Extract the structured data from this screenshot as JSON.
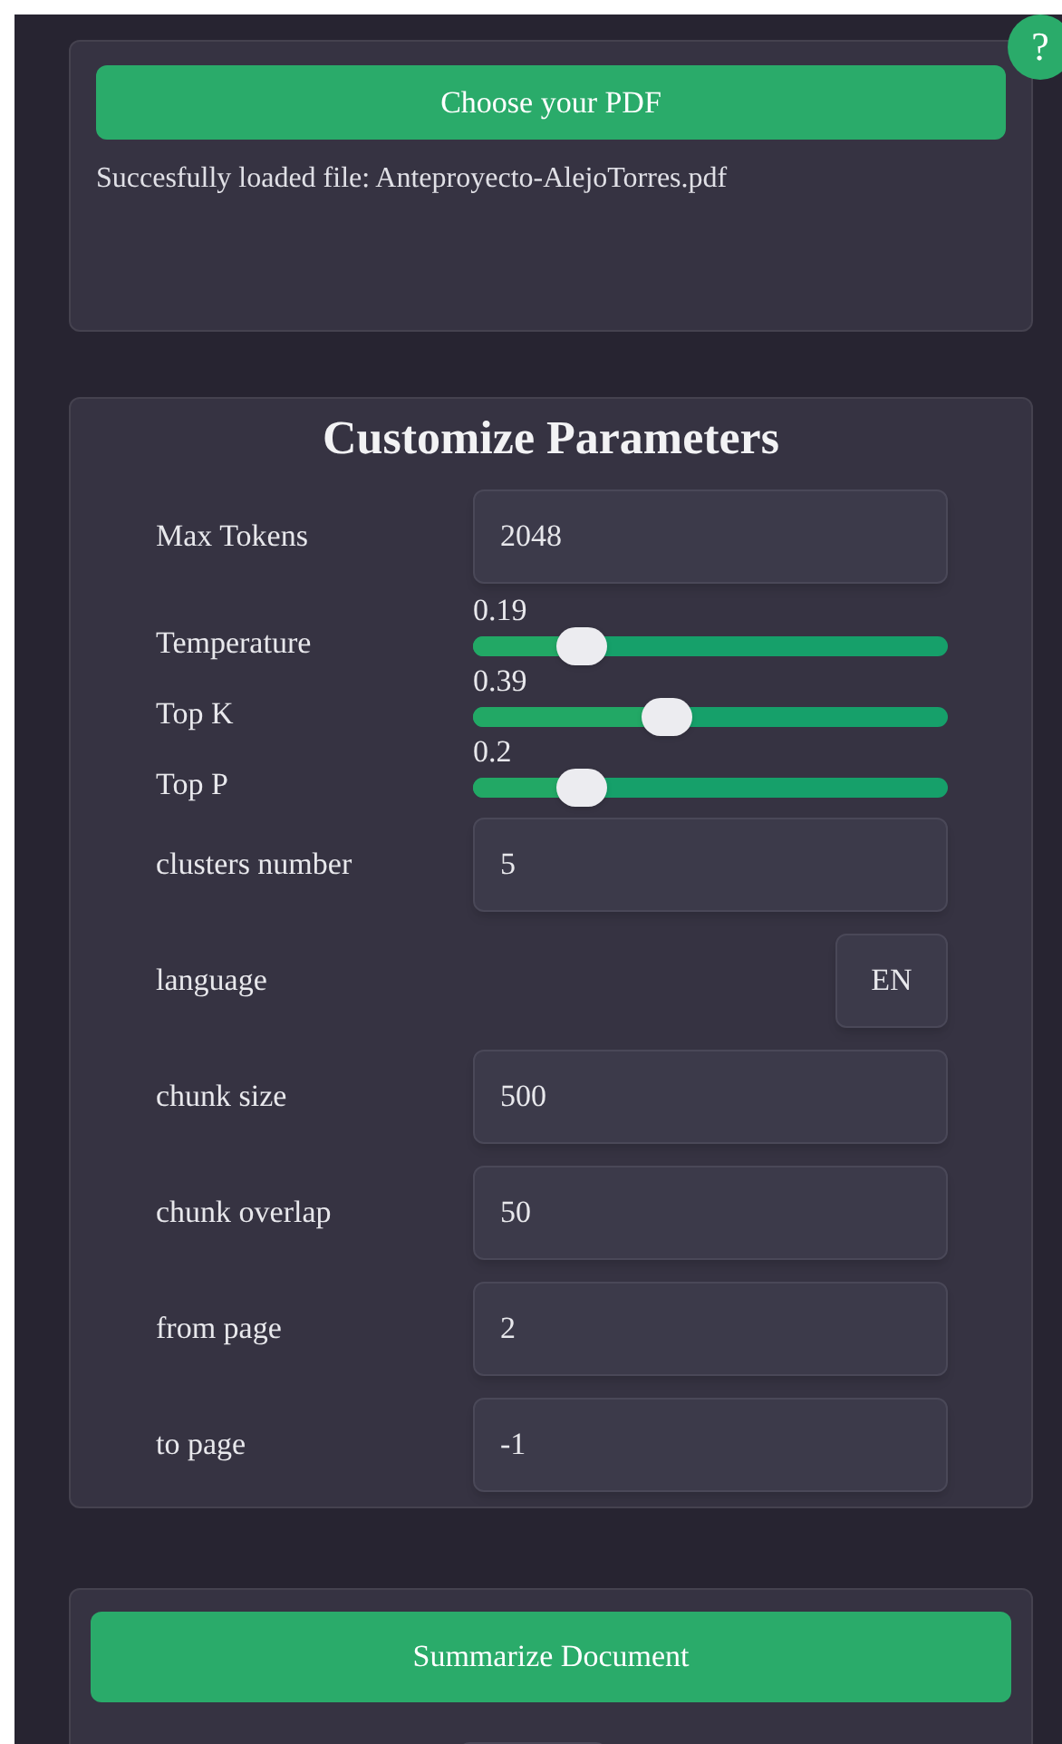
{
  "upload": {
    "button": "Choose your PDF",
    "status": "Succesfully loaded file: Anteproyecto-AlejoTorres.pdf",
    "help": "?"
  },
  "parameters": {
    "title": "Customize Parameters",
    "rows": [
      {
        "kind": "field",
        "label": "Max Tokens",
        "value": "2048"
      },
      {
        "kind": "slider",
        "label": "Temperature",
        "reading": "0.19",
        "level": 0.23
      },
      {
        "kind": "slider",
        "label": "Top K",
        "reading": "0.39",
        "level": 0.41
      },
      {
        "kind": "slider",
        "label": "Top P",
        "reading": "0.2",
        "level": 0.23
      },
      {
        "kind": "field",
        "label": "clusters number",
        "value": "5"
      },
      {
        "kind": "toggle",
        "label": "language",
        "value": "EN"
      },
      {
        "kind": "field",
        "label": "chunk size",
        "value": "500"
      },
      {
        "kind": "field",
        "label": "chunk overlap",
        "value": "50"
      },
      {
        "kind": "field",
        "label": "from page",
        "value": "2"
      },
      {
        "kind": "field",
        "label": "to page",
        "value": "-1"
      }
    ]
  },
  "summary": {
    "button": "Summarize Document"
  }
}
